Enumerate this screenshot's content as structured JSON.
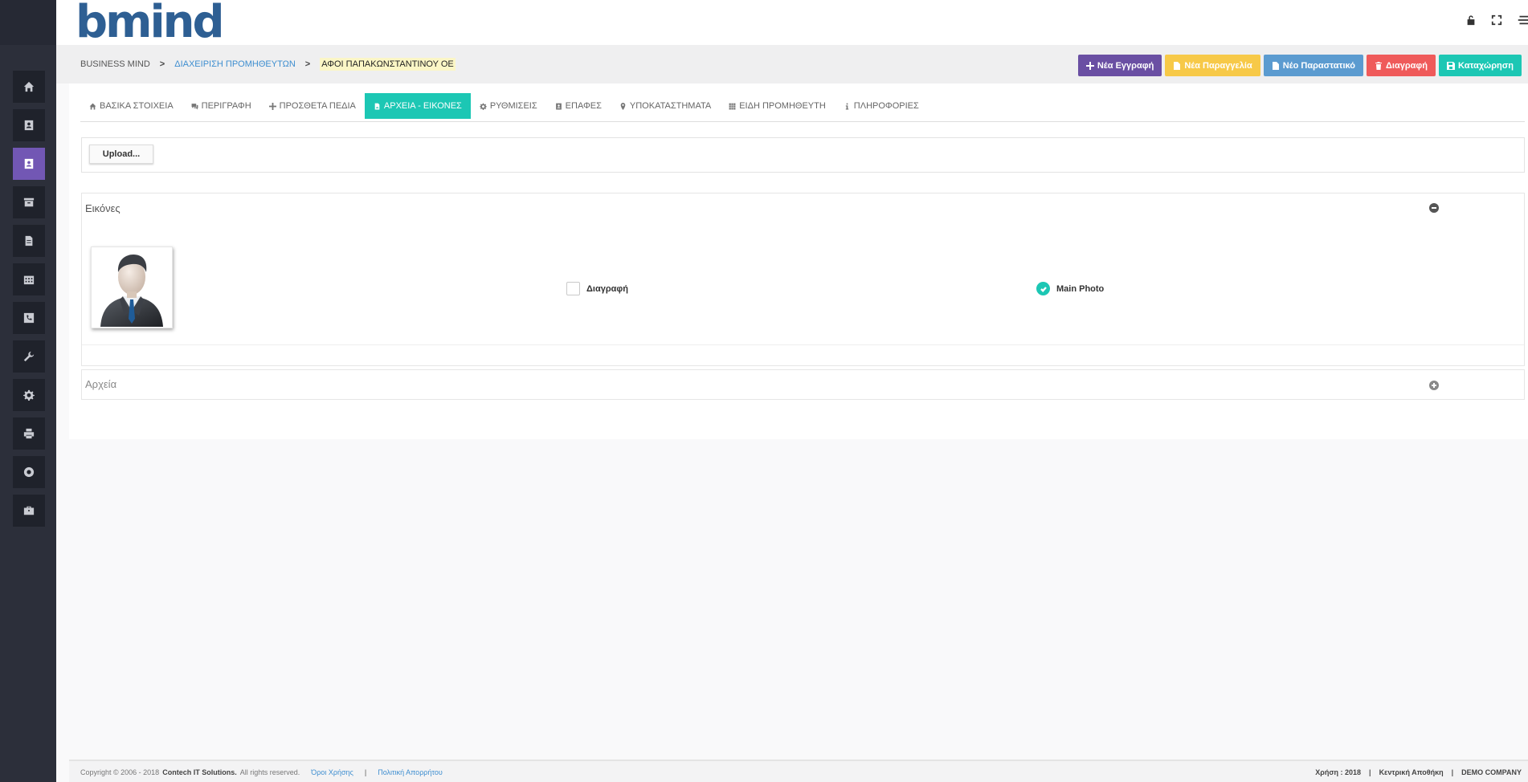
{
  "brand": {
    "logo_text": "bmind",
    "color": "#2e5f93"
  },
  "sidebar": {
    "items": [
      {
        "icon": "home-icon"
      },
      {
        "icon": "contact-card-icon"
      },
      {
        "icon": "supplier-contact-icon",
        "active": true
      },
      {
        "icon": "archive-box-icon"
      },
      {
        "icon": "document-icon"
      },
      {
        "icon": "calendar-icon"
      },
      {
        "icon": "phone-icon"
      },
      {
        "icon": "wrench-icon"
      },
      {
        "icon": "gear-icon"
      },
      {
        "icon": "printer-icon"
      },
      {
        "icon": "lifebuoy-icon"
      },
      {
        "icon": "briefcase-icon"
      }
    ],
    "active_color": "#7257b4"
  },
  "top_icons": [
    "unlock-icon",
    "fullscreen-icon",
    "menu-icon"
  ],
  "breadcrumb": {
    "root": "BUSINESS MIND",
    "section": "ΔΙΑΧΕΙΡΙΣΗ ΠΡΟΜΗΘΕΥΤΩΝ",
    "current": "ΑΦΟΙ ΠΑΠΑΚΩΝΣΤΑΝΤΙΝΟΥ ΟΕ"
  },
  "actions": {
    "new_record": {
      "label": "Νέα Εγγραφή",
      "color": "#6a4fa3",
      "icon": "plus-icon"
    },
    "new_order": {
      "label": "Νέα Παραγγελία",
      "color": "#f7c948",
      "icon": "file-icon"
    },
    "new_document": {
      "label": "Νέο Παραστατικό",
      "color": "#5b9bd0",
      "icon": "file-icon"
    },
    "delete": {
      "label": "Διαγραφή",
      "color": "#ef5a5a",
      "icon": "trash-icon"
    },
    "save": {
      "label": "Καταχώρηση",
      "color": "#1cc7b4",
      "icon": "floppy-icon"
    }
  },
  "tabs": [
    {
      "label": "ΒΑΣΙΚΑ ΣΤΟΙΧΕΙΑ",
      "icon": "home-icon"
    },
    {
      "label": "ΠΕΡΙΓΡΑΦΗ",
      "icon": "comments-icon"
    },
    {
      "label": "ΠΡΟΣΘΕΤΑ ΠΕΔΙΑ",
      "icon": "plus-icon"
    },
    {
      "label": "ΑΡΧΕΙΑ - ΕΙΚΟΝΕΣ",
      "icon": "file-image-icon",
      "active": true
    },
    {
      "label": "ΡΥΘΜΙΣΕΙΣ",
      "icon": "gear-icon"
    },
    {
      "label": "ΕΠΑΦΕΣ",
      "icon": "contact-card-icon"
    },
    {
      "label": "ΥΠΟΚΑΤΑΣΤΗΜΑΤΑ",
      "icon": "map-marker-icon"
    },
    {
      "label": "ΕΙΔΗ ΠΡΟΜΗΘΕΥΤΗ",
      "icon": "grid-icon"
    },
    {
      "label": "ΠΛΗΡΟΦΟΡΙΕΣ",
      "icon": "info-icon"
    }
  ],
  "upload": {
    "label": "Upload..."
  },
  "images_section": {
    "title": "Εικόνες",
    "image": {
      "icon": "businessman-avatar-icon"
    },
    "delete_label": "Διαγραφή",
    "delete_checked": false,
    "main_photo_label": "Main Photo",
    "main_photo_checked": true
  },
  "files_section": {
    "title": "Αρχεία"
  },
  "footer": {
    "copyright_prefix": "Copyright © 2006 - 2018",
    "company": "Contech IT Solutions.",
    "rights": "All rights reserved.",
    "terms": "Όροι Χρήσης",
    "privacy": "Πολιτική Απορρήτου",
    "year": "Χρήση : 2018",
    "warehouse": "Κεντρική Αποθήκη",
    "demo": "DEMO COMPANY"
  }
}
